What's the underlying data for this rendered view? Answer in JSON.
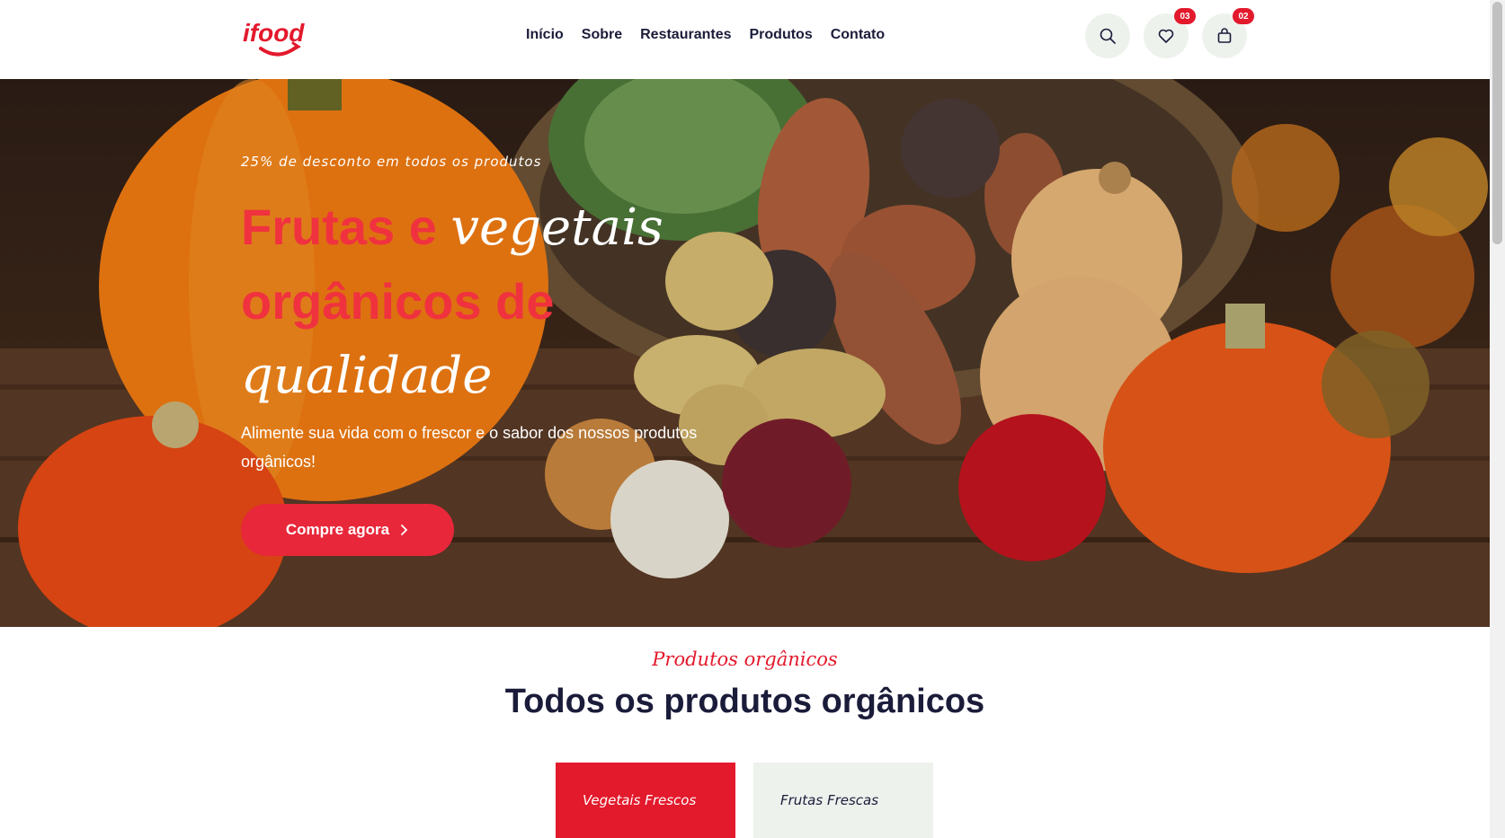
{
  "brand": {
    "logo_text": "ifood",
    "color": "#e3192c"
  },
  "nav": {
    "items": [
      {
        "label": "Início"
      },
      {
        "label": "Sobre"
      },
      {
        "label": "Restaurantes"
      },
      {
        "label": "Produtos"
      },
      {
        "label": "Contato"
      }
    ]
  },
  "header_icons": {
    "search": {
      "icon": "search-icon"
    },
    "wishlist": {
      "icon": "heart-icon",
      "count": "03"
    },
    "cart": {
      "icon": "shopping-bag-icon",
      "count": "02"
    }
  },
  "hero": {
    "subtitle": "25% de desconto em todos os produtos",
    "title_part1": "Frutas e ",
    "title_part2": "vegetais",
    "title_part3": "orgânicos de",
    "title_part4": "qualidade",
    "description": "Alimente sua vida com o frescor e o sabor dos nossos produtos orgânicos!",
    "cta_label": "Compre agora",
    "cta_icon": "chevron-right-icon"
  },
  "section": {
    "kicker": "Produtos orgânicos",
    "title": "Todos os produtos orgânicos",
    "tabs": [
      {
        "label": "Vegetais Frescos",
        "active": true
      },
      {
        "label": "Frutas Frescas",
        "active": false
      }
    ]
  },
  "colors": {
    "accent": "#e3192c",
    "dark": "#1b1c3a",
    "soft_bg": "#eef2ed"
  }
}
